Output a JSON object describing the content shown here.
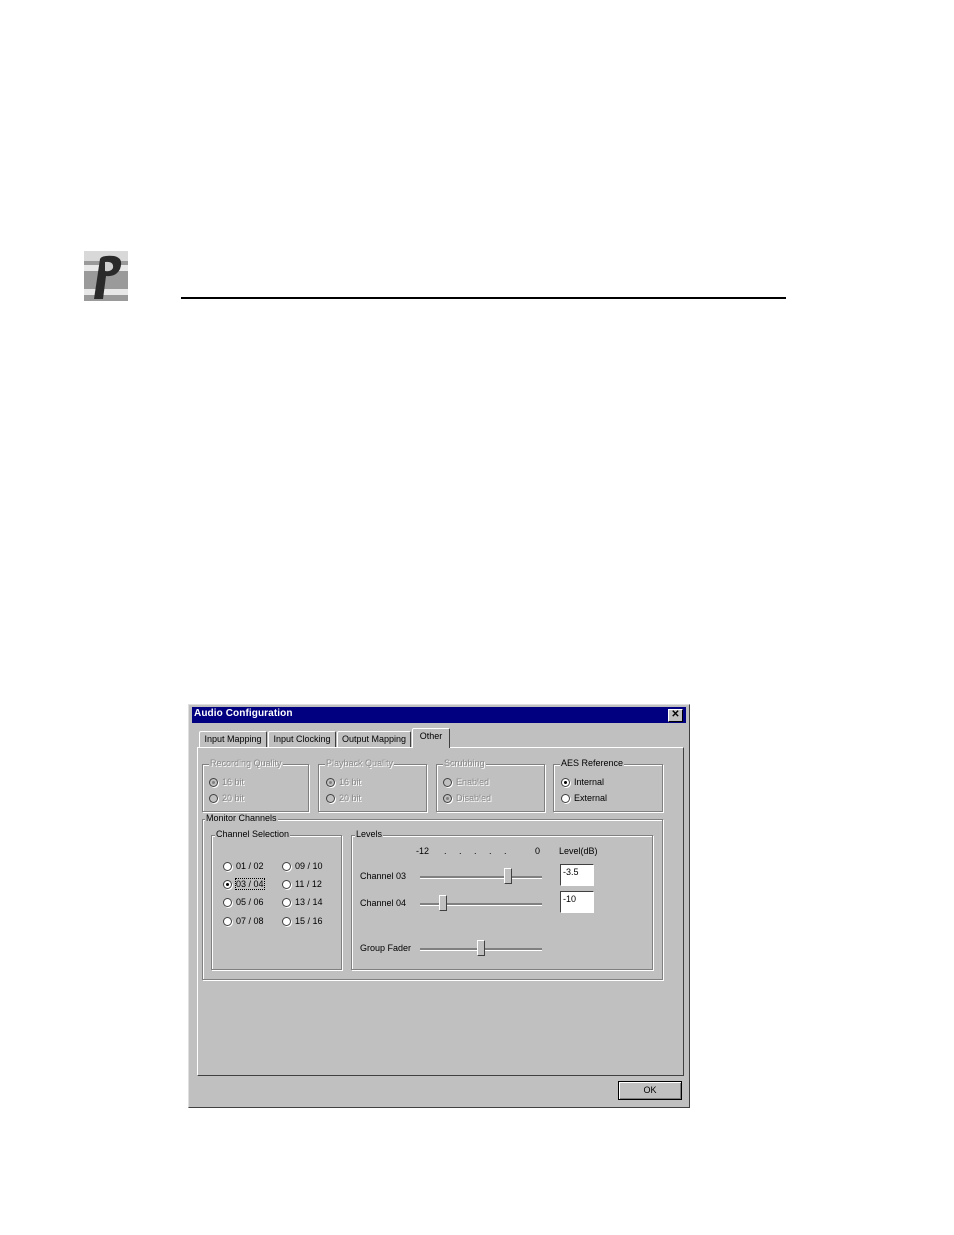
{
  "window": {
    "title": "Audio Configuration",
    "close_glyph": "✕"
  },
  "tabs": [
    {
      "label": "Input Mapping"
    },
    {
      "label": "Input Clocking"
    },
    {
      "label": "Output Mapping"
    },
    {
      "label": "Other",
      "selected": true
    }
  ],
  "recording_quality": {
    "label": "Recording Quality",
    "options": [
      "16 bit",
      "20 bit"
    ],
    "selected": "16 bit",
    "disabled": true
  },
  "playback_quality": {
    "label": "Playback Quality",
    "options": [
      "16 bit",
      "20 bit"
    ],
    "selected": "16 bit",
    "disabled": true
  },
  "scrubbing": {
    "label": "Scrubbing",
    "options": [
      "Enabled",
      "Disabled"
    ],
    "selected": "Disabled",
    "disabled": true
  },
  "aes_reference": {
    "label": "AES Reference",
    "options": [
      "Internal",
      "External"
    ],
    "selected": "Internal"
  },
  "monitor_channels": {
    "label": "Monitor Channels",
    "channel_selection": {
      "label": "Channel Selection",
      "options": [
        "01 / 02",
        "03 / 04",
        "05 / 06",
        "07 / 08",
        "09 / 10",
        "11 / 12",
        "13 / 14",
        "15 / 16"
      ],
      "selected": "03 / 04"
    },
    "levels": {
      "label": "Levels",
      "scale_min": "-12",
      "scale_dots": ". . . . .",
      "scale_max": "0",
      "level_header": "Level(dB)",
      "channel_a": {
        "label": "Channel 03",
        "value": "-3.5",
        "slider_fraction": 0.74
      },
      "channel_b": {
        "label": "Channel 04",
        "value": "-10",
        "slider_fraction": 0.17
      },
      "group_fader": {
        "label": "Group Fader",
        "slider_fraction": 0.5
      }
    }
  },
  "ok_label": "OK",
  "colors": {
    "titlebar": "#000080",
    "face": "#c0c0c0"
  }
}
